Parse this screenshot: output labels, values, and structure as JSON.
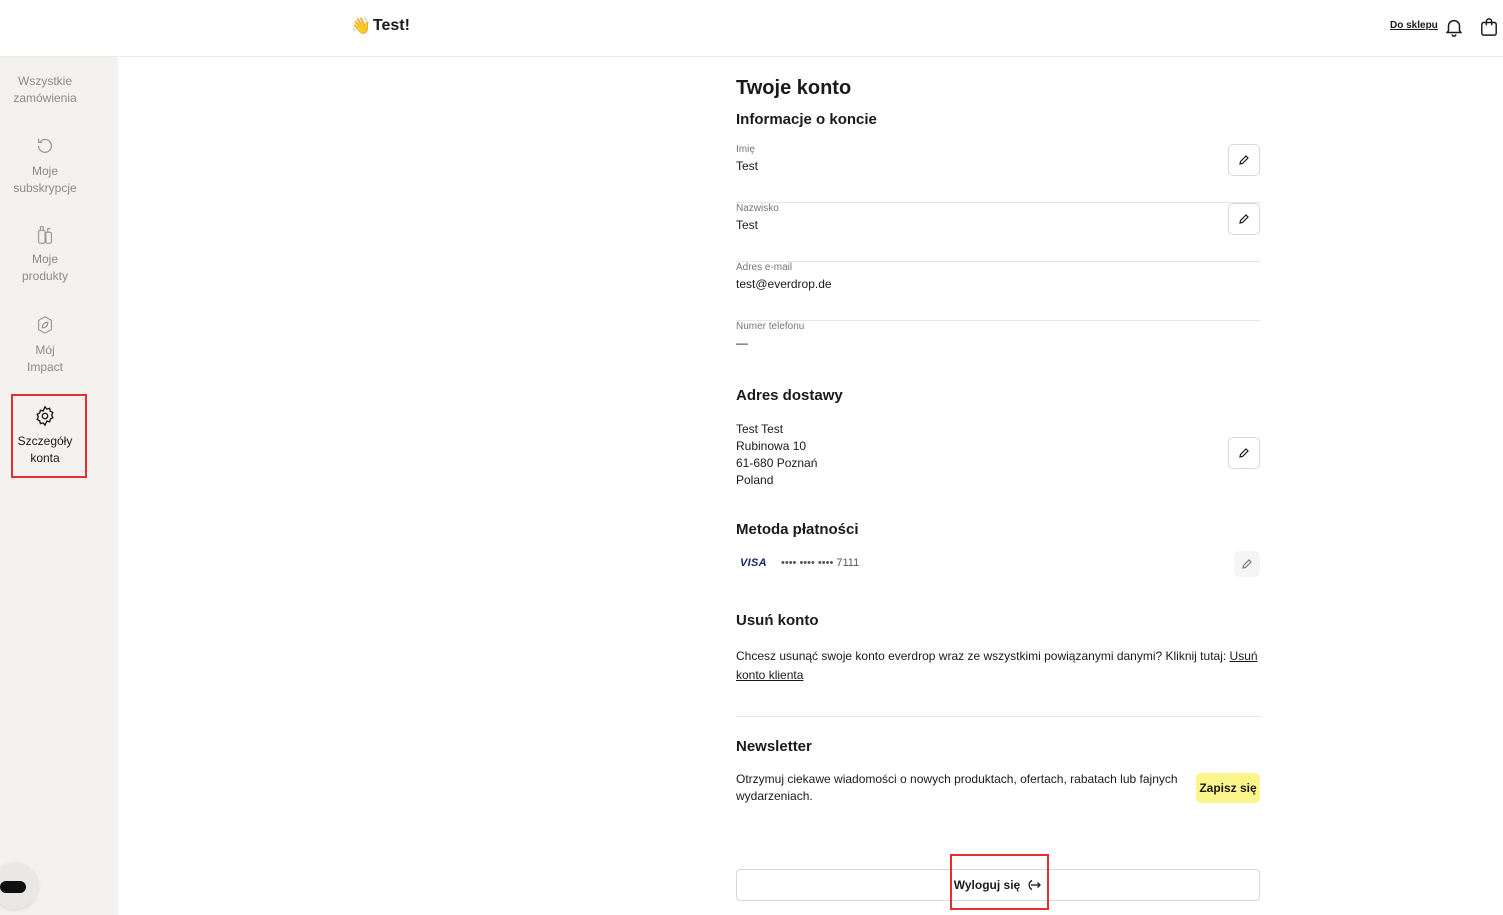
{
  "header": {
    "greeting_emoji": "👋",
    "greeting": "Test!",
    "shop_link": "Do sklepu",
    "bell_icon": "bell-icon",
    "cart_icon": "cart-icon"
  },
  "sidebar": {
    "items": [
      {
        "label_line1": "Wszystkie",
        "label_line2": "zamówienia",
        "icon": "orders-icon"
      },
      {
        "label_line1": "Moje",
        "label_line2": "subskrypcje",
        "icon": "refresh-icon"
      },
      {
        "label_line1": "Moje",
        "label_line2": "produkty",
        "icon": "bottles-icon"
      },
      {
        "label_line1": "Mój",
        "label_line2": "Impact",
        "icon": "leaf-icon"
      },
      {
        "label_line1": "Szczegóły",
        "label_line2": "konta",
        "icon": "gear-icon",
        "active": true
      }
    ]
  },
  "main": {
    "title": "Twoje konto",
    "account_info": {
      "title": "Informacje o koncie",
      "fields": [
        {
          "label": "Imię",
          "value": "Test",
          "editable": true
        },
        {
          "label": "Nazwisko",
          "value": "Test",
          "editable": true
        },
        {
          "label": "Adres e-mail",
          "value": "test@everdrop.de",
          "editable": false
        },
        {
          "label": "Numer telefonu",
          "value": "—",
          "editable": false
        }
      ]
    },
    "shipping": {
      "title": "Adres dostawy",
      "lines": [
        "Test Test",
        "Rubinowa 10",
        "61-680 Poznań",
        "Poland"
      ]
    },
    "payment": {
      "title": "Metoda płatności",
      "brand": "VISA",
      "masked_number": "•••• •••• •••• 7111"
    },
    "delete": {
      "title": "Usuń konto",
      "text": "Chcesz usunąć swoje konto everdrop wraz ze wszystkimi powiązanymi danymi? Kliknij tutaj: ",
      "link": "Usuń konto klienta"
    },
    "newsletter": {
      "title": "Newsletter",
      "text": "Otrzymuj ciekawe wiadomości o nowych produktach, ofertach, rabatach lub fajnych wydarzeniach.",
      "button": "Zapisz się"
    },
    "logout": {
      "label": "Wyloguj się",
      "icon": "logout-icon"
    }
  },
  "colors": {
    "highlight": "#e03030",
    "subscribe_bg": "#fbf58a",
    "sidebar_bg": "#f3f2ef",
    "visa": "#1a1f71"
  }
}
